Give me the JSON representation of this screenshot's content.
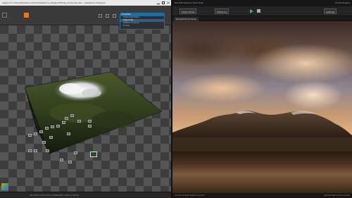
{
  "left_app": {
    "title": "sbsprs 0  C:/Users/fan/Documents/Substance_designer/ffmap_landscape.sbs - Substance Designer",
    "properties_panel": {
      "header": "Properties",
      "rows": [
        "Graph parameters",
        "Output size",
        "Relative to parent",
        "Format"
      ]
    },
    "status_text": "2D VIEW 1024x1024 (RGBA16F) 100%  0.07ms"
  },
  "right_app": {
    "menubar_left": "File  Edit  Window  Tools  Help",
    "menubar_right": "Unreal Engine",
    "toolbar_buttons": [
      "Select Mode",
      "Platforms",
      "Settings"
    ],
    "viewport_tab": "Perspective  Lit  Show",
    "status_left": "Content Drawer   Output Log   Cmd",
    "status_right": "Derived Data   Source Control"
  },
  "colors": {
    "accent": "#1c6ea4",
    "toolbar_orange": "#e07a2a"
  }
}
